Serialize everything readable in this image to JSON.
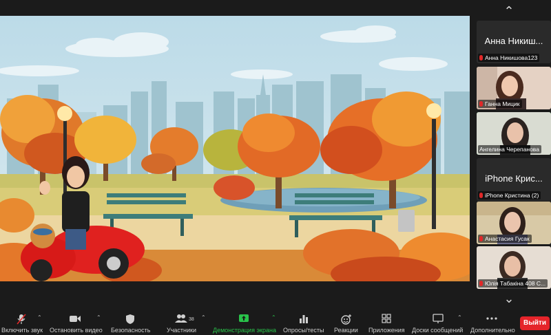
{
  "gallery": {
    "tiles": [
      {
        "big_name": "Анна Никиш...",
        "label": "Анна Никишова123",
        "type": "avatar"
      },
      {
        "label": "Ганна Мицик",
        "type": "video"
      },
      {
        "label": "Ангелина Черепанова",
        "type": "video",
        "active": true
      },
      {
        "big_name": "iPhone Крис...",
        "label": "iPhone Кристина (2)",
        "type": "avatar"
      },
      {
        "label": "Анастасия Гусак",
        "type": "video"
      },
      {
        "label": "Юлія Табакіна 408 С...",
        "type": "video"
      }
    ]
  },
  "toolbar": {
    "mute": "Включить звук",
    "video": "Остановить видео",
    "security": "Безопасность",
    "participants": "Участники",
    "participants_count": "38",
    "share": "Демонстрация экрана",
    "polls": "Опросы/тесты",
    "reactions": "Реакции",
    "apps": "Приложения",
    "whiteboards": "Доски сообщений",
    "more": "Дополнительно",
    "leave": "Выйти"
  },
  "colors": {
    "share_active": "#29c24a",
    "leave": "#e5242a",
    "active_speaker": "#4cd964",
    "muted_mic": "#e02828"
  }
}
